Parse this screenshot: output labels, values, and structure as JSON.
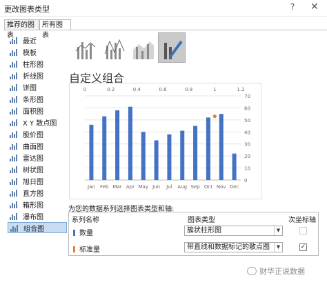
{
  "window": {
    "title": "更改图表类型",
    "help": "?",
    "close": "✕"
  },
  "tabs": [
    {
      "label": "推荐的图表"
    },
    {
      "label": "所有图表"
    }
  ],
  "sidebar": {
    "items": [
      {
        "label": "最近",
        "icon": "recent-icon"
      },
      {
        "label": "模板",
        "icon": "template-icon"
      },
      {
        "label": "柱形图",
        "icon": "column-chart-icon"
      },
      {
        "label": "折线图",
        "icon": "line-chart-icon"
      },
      {
        "label": "饼图",
        "icon": "pie-chart-icon"
      },
      {
        "label": "条形图",
        "icon": "bar-chart-icon"
      },
      {
        "label": "面积图",
        "icon": "area-chart-icon"
      },
      {
        "label": "X Y 散点图",
        "icon": "scatter-chart-icon"
      },
      {
        "label": "股价图",
        "icon": "stock-chart-icon"
      },
      {
        "label": "曲面图",
        "icon": "surface-chart-icon"
      },
      {
        "label": "雷达图",
        "icon": "radar-chart-icon"
      },
      {
        "label": "树状图",
        "icon": "treemap-chart-icon"
      },
      {
        "label": "旭日图",
        "icon": "sunburst-chart-icon"
      },
      {
        "label": "直方图",
        "icon": "histogram-chart-icon"
      },
      {
        "label": "箱形图",
        "icon": "box-chart-icon"
      },
      {
        "label": "瀑布图",
        "icon": "waterfall-chart-icon"
      },
      {
        "label": "组合图",
        "icon": "combo-chart-icon"
      }
    ],
    "selected": 16
  },
  "thumbnails": [
    {
      "icon": "clustered-column-line-icon"
    },
    {
      "icon": "column-line-secondary-axis-icon"
    },
    {
      "icon": "stacked-area-column-icon"
    },
    {
      "icon": "custom-combination-icon"
    }
  ],
  "section_title": "自定义组合",
  "chart_data": {
    "type": "bar",
    "categories": [
      "Jan",
      "Feb",
      "Mar",
      "Apr",
      "May",
      "Jun",
      "Jul",
      "Aug",
      "Sep",
      "Oct",
      "Nov",
      "Dec"
    ],
    "series": [
      {
        "name": "数量",
        "type": "bar",
        "axis": "primary",
        "values": [
          46,
          53,
          58,
          61,
          40,
          33,
          38,
          41,
          45,
          52,
          55,
          22
        ],
        "color": "#4472c4"
      },
      {
        "name": "标准量",
        "type": "scatter",
        "axis": "secondary",
        "points": [
          {
            "x": 1.0,
            "y": 53
          }
        ],
        "color": "#ed7d31"
      }
    ],
    "primary_y": {
      "min": 0,
      "max": 70,
      "ticks": [
        0,
        10,
        20,
        30,
        40,
        50,
        60,
        70
      ]
    },
    "secondary_x": {
      "min": 0,
      "max": 1.2,
      "ticks": [
        "0",
        "0.2",
        "0.4",
        "0.6",
        "0.8",
        "1",
        "1.2"
      ]
    },
    "right_y_ticks": [
      "0",
      "10",
      "20",
      "30",
      "40",
      "50",
      "60",
      "70"
    ],
    "grid": true
  },
  "assign_label": "为您的数据系列选择图表类型和轴:",
  "table": {
    "headers": {
      "name": "系列名称",
      "type": "图表类型",
      "axis": "次坐标轴"
    },
    "rows": [
      {
        "name": "数量",
        "color": "#4472c4",
        "chart_type": "簇状柱形图",
        "secondary": false
      },
      {
        "name": "标准量",
        "color": "#ed7d31",
        "chart_type": "带直线和数据标记的散点图",
        "secondary": true
      }
    ]
  },
  "watermark": "财华正说数据",
  "dropdown_arrow": "▼",
  "check_mark": "✓"
}
